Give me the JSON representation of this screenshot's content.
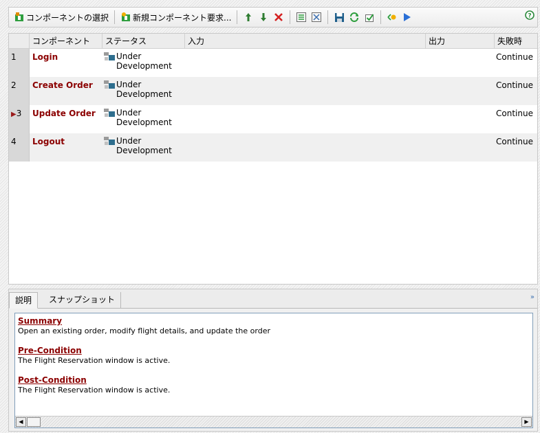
{
  "toolbar": {
    "select_component_label": "コンポーネントの選択",
    "new_component_request_label": "新規コンポーネント要求...",
    "icons": [
      "move-up-icon",
      "move-down-icon",
      "delete-icon",
      "expand-icon",
      "collapse-icon",
      "save-icon",
      "refresh-icon",
      "check-icon",
      "parameters-icon",
      "run-icon",
      "help-icon"
    ]
  },
  "grid": {
    "columns": [
      "コンポーネント",
      "ステータス",
      "入力",
      "出力",
      "失敗時"
    ],
    "rows": [
      {
        "num": "1",
        "component": "Login",
        "status_line1": "Under",
        "status_line2": "Development",
        "on_failure": "Continue",
        "current": false
      },
      {
        "num": "2",
        "component": "Create Order",
        "status_line1": "Under",
        "status_line2": "Development",
        "on_failure": "Continue",
        "current": false
      },
      {
        "num": "3",
        "component": "Update Order",
        "status_line1": "Under",
        "status_line2": "Development",
        "on_failure": "Continue",
        "current": true
      },
      {
        "num": "4",
        "component": "Logout",
        "status_line1": "Under",
        "status_line2": "Development",
        "on_failure": "Continue",
        "current": false
      }
    ]
  },
  "bottom": {
    "tabs": [
      "説明",
      "スナップショット"
    ],
    "sections": [
      {
        "title": "Summary",
        "body": "Open an existing order, modify flight details, and update the order"
      },
      {
        "title": "Pre-Condition",
        "body": "The Flight Reservation window is active."
      },
      {
        "title": "Post-Condition",
        "body": "The Flight Reservation window is active."
      }
    ]
  },
  "colors": {
    "component_text": "#8b0000",
    "run_icon": "#2a6fd6",
    "delete_icon": "#d42020"
  }
}
